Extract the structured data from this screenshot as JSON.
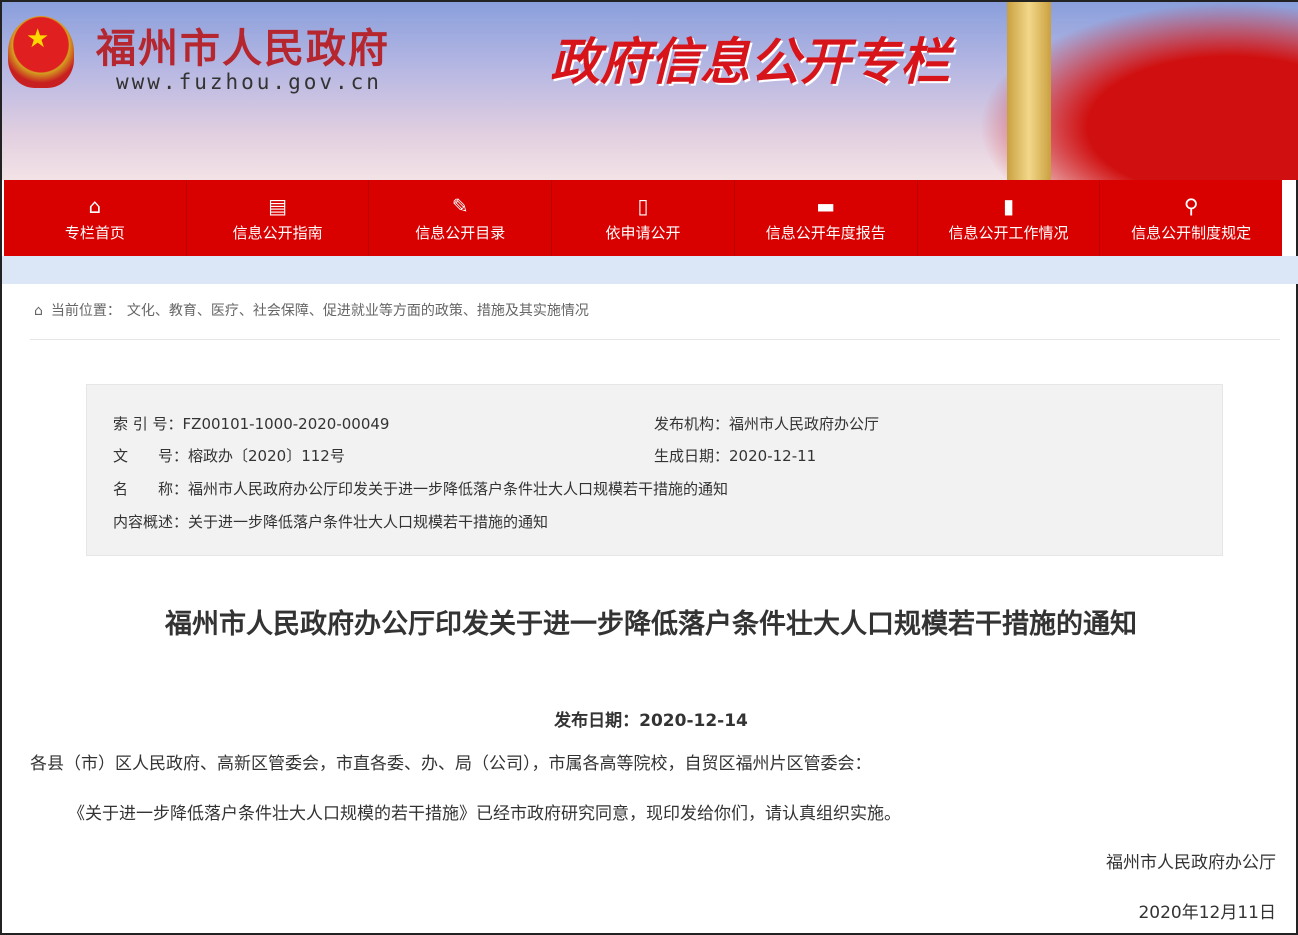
{
  "header": {
    "site_name": "福州市人民政府",
    "site_url": "www.fuzhou.gov.cn",
    "column_title": "政府信息公开专栏"
  },
  "nav": [
    {
      "label": "专栏首页",
      "icon": "home-icon",
      "glyph": "⌂"
    },
    {
      "label": "信息公开指南",
      "icon": "guide-icon",
      "glyph": "▤"
    },
    {
      "label": "信息公开目录",
      "icon": "catalog-icon",
      "glyph": "✎"
    },
    {
      "label": "依申请公开",
      "icon": "document-icon",
      "glyph": "▯"
    },
    {
      "label": "信息公开年度报告",
      "icon": "folder-icon",
      "glyph": "▬"
    },
    {
      "label": "信息公开工作情况",
      "icon": "notebook-icon",
      "glyph": "▮"
    },
    {
      "label": "信息公开制度规定",
      "icon": "search-icon",
      "glyph": "⚲"
    }
  ],
  "breadcrumb": {
    "label": "当前位置：",
    "path": "文化、教育、医疗、社会保障、促进就业等方面的政策、措施及其实施情况"
  },
  "meta": {
    "index_label": "索 引 号：",
    "index_value": "FZ00101-1000-2020-00049",
    "publisher_label": "发布机构：",
    "publisher_value": "福州市人民政府办公厅",
    "doc_no_label": "文　　号：",
    "doc_no_value": "榕政办〔2020〕112号",
    "created_label": "生成日期：",
    "created_value": "2020-12-11",
    "name_label": "名　　称：",
    "name_value": "福州市人民政府办公厅印发关于进一步降低落户条件壮大人口规模若干措施的通知",
    "summary_label": "内容概述：",
    "summary_value": "关于进一步降低落户条件壮大人口规模若干措施的通知"
  },
  "article": {
    "title": "福州市人民政府办公厅印发关于进一步降低落户条件壮大人口规模若干措施的通知",
    "publish_date": "发布日期：2020-12-14",
    "salutation": "各县（市）区人民政府、高新区管委会，市直各委、办、局（公司），市属各高等院校，自贸区福州片区管委会：",
    "body": "《关于进一步降低落户条件壮大人口规模的若干措施》已经市政府研究同意，现印发给你们，请认真组织实施。",
    "signer": "福州市人民政府办公厅",
    "sign_date": "2020年12月11日"
  }
}
